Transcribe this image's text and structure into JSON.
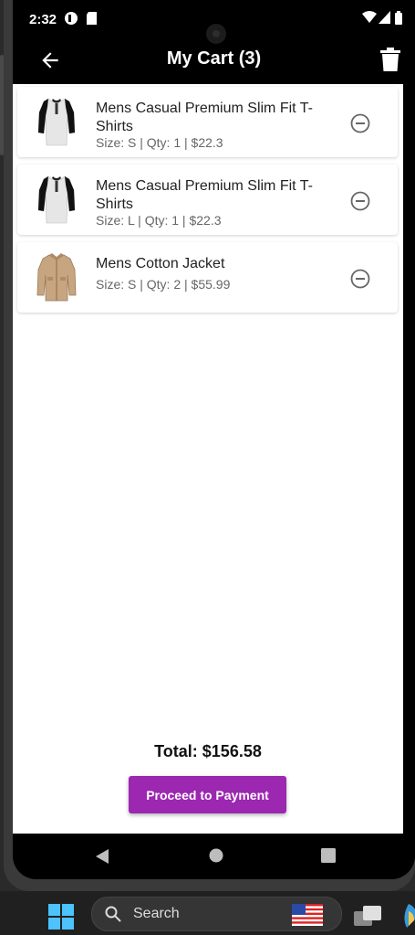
{
  "status_bar": {
    "time": "2:32"
  },
  "app_bar": {
    "title": "My Cart (3)"
  },
  "cart": {
    "items": [
      {
        "title": "Mens Casual Premium Slim Fit T-Shirts",
        "details": "Size: S | Qty: 1 | $22.3",
        "thumbnail": "raglan-tshirt"
      },
      {
        "title": "Mens Casual Premium Slim Fit T-Shirts",
        "details": "Size: L | Qty: 1 | $22.3",
        "thumbnail": "raglan-tshirt"
      },
      {
        "title": "Mens Cotton Jacket",
        "details": "Size: S | Qty: 2 | $55.99",
        "thumbnail": "khaki-jacket"
      }
    ],
    "total": "Total: $156.58",
    "pay_label": "Proceed to Payment"
  },
  "taskbar": {
    "search_label": "Search"
  },
  "colors": {
    "accent": "#9c27b0",
    "app_bar": "#000000"
  },
  "icons": [
    "back-arrow-icon",
    "trash-icon",
    "remove-circle-icon",
    "nav-back-icon",
    "nav-home-icon",
    "nav-recents-icon",
    "windows-logo-icon",
    "search-icon",
    "us-flag-icon",
    "task-view-icon"
  ]
}
